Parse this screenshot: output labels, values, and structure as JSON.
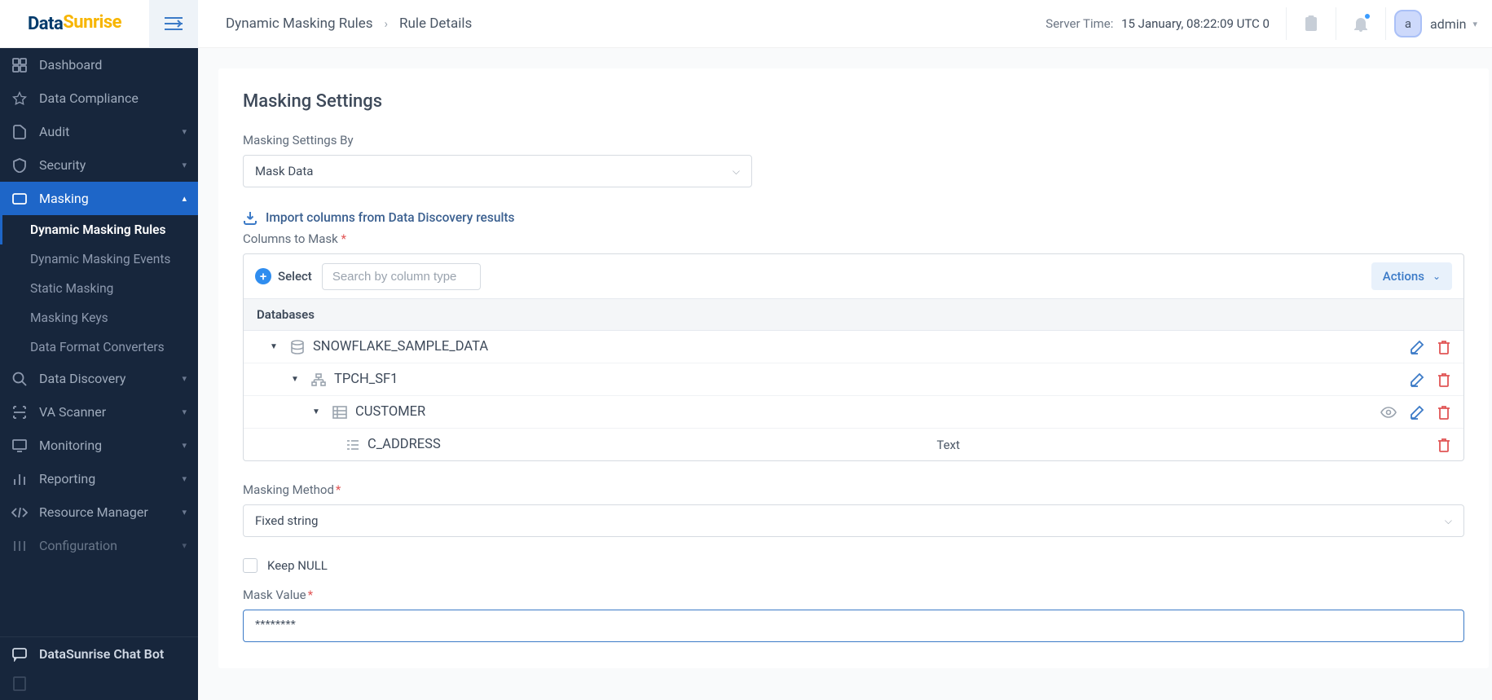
{
  "logo": {
    "part1": "Data",
    "part2": "Sunrise"
  },
  "breadcrumb": {
    "parent": "Dynamic Masking Rules",
    "current": "Rule Details"
  },
  "server": {
    "label": "Server Time:",
    "value": "15 January, 08:22:09  UTC 0"
  },
  "user": {
    "initial": "a",
    "name": "admin"
  },
  "sidebar": {
    "items": [
      {
        "label": "Dashboard"
      },
      {
        "label": "Data Compliance"
      },
      {
        "label": "Audit"
      },
      {
        "label": "Security"
      },
      {
        "label": "Masking"
      },
      {
        "label": "Data Discovery"
      },
      {
        "label": "VA Scanner"
      },
      {
        "label": "Monitoring"
      },
      {
        "label": "Reporting"
      },
      {
        "label": "Resource Manager"
      },
      {
        "label": "Configuration"
      }
    ],
    "masking_sub": [
      "Dynamic Masking Rules",
      "Dynamic Masking Events",
      "Static Masking",
      "Masking Keys",
      "Data Format Converters"
    ],
    "chat": "DataSunrise Chat Bot"
  },
  "page": {
    "heading": "Masking Settings",
    "settings_by_label": "Masking Settings By",
    "settings_by_value": "Mask Data",
    "import_link": "Import columns from Data Discovery results",
    "columns_label": "Columns to Mask",
    "select_btn": "Select",
    "search_placeholder": "Search by column type",
    "actions": "Actions",
    "db_header": "Databases",
    "tree": {
      "database": "SNOWFLAKE_SAMPLE_DATA",
      "schema": "TPCH_SF1",
      "table": "CUSTOMER",
      "column": "C_ADDRESS",
      "column_type": "Text"
    },
    "method_label": "Masking Method",
    "method_value": "Fixed string",
    "keep_null": "Keep NULL",
    "mask_value_label": "Mask Value",
    "mask_value": "********"
  }
}
